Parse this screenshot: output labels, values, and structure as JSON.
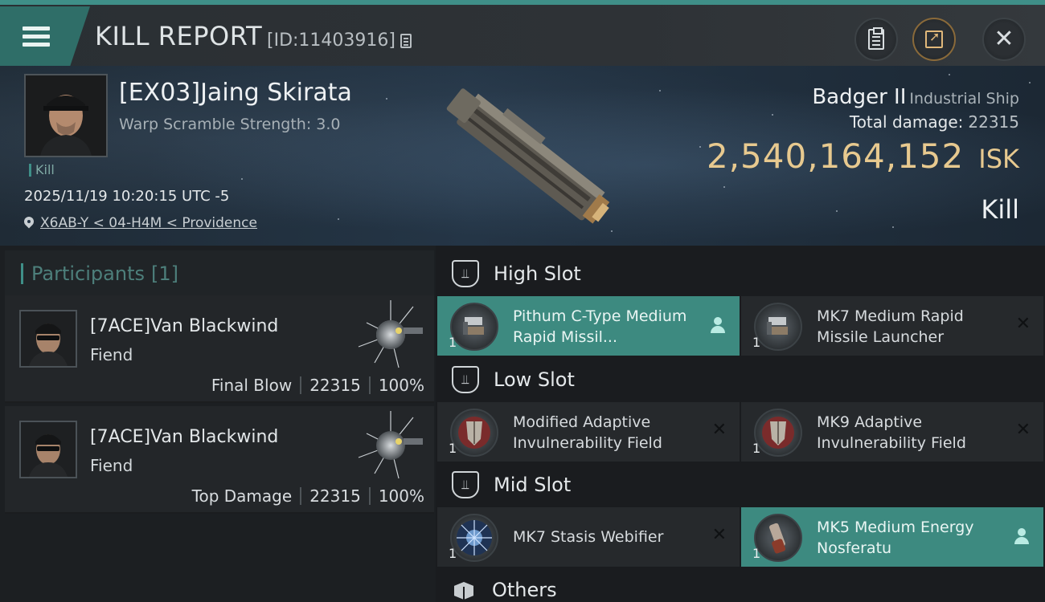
{
  "header": {
    "title": "KILL REPORT",
    "report_id": "[ID:11403916]"
  },
  "victim": {
    "name": "[EX03]Jaing Skirata",
    "warp_scramble": "Warp Scramble Strength: 3.0",
    "tag": "Kill",
    "timestamp": "2025/11/19 10:20:15 UTC -5",
    "location": "X6AB-Y < 04-H4M < Providence"
  },
  "ship": {
    "name": "Badger II",
    "class": "Industrial Ship",
    "total_damage_label": "Total damage:",
    "total_damage_value": "22315",
    "isk_value": "2,540,164,152",
    "isk_unit": "ISK",
    "result": "Kill"
  },
  "participants": {
    "label": "Participants",
    "count": "[1]",
    "items": [
      {
        "name": "[7ACE]Van Blackwind",
        "ship": "Fiend",
        "role": "Final Blow",
        "damage": "22315",
        "percent": "100%"
      },
      {
        "name": "[7ACE]Van Blackwind",
        "ship": "Fiend",
        "role": "Top Damage",
        "damage": "22315",
        "percent": "100%"
      }
    ]
  },
  "slots": {
    "high": {
      "title": "High Slot",
      "modules": [
        {
          "name": "Pithum C-Type Medium Rapid Missil...",
          "qty": "1",
          "status": "fitted"
        },
        {
          "name": "MK7 Medium Rapid Missile Launcher",
          "qty": "1",
          "status": "destroyed"
        }
      ]
    },
    "low": {
      "title": "Low Slot",
      "modules": [
        {
          "name": "Modified Adaptive Invulnerability Field",
          "qty": "1",
          "status": "destroyed"
        },
        {
          "name": "MK9 Adaptive Invulnerability Field",
          "qty": "1",
          "status": "destroyed"
        }
      ]
    },
    "mid": {
      "title": "Mid Slot",
      "modules": [
        {
          "name": "MK7 Stasis Webifier",
          "qty": "1",
          "status": "destroyed"
        },
        {
          "name": "MK5 Medium Energy Nosferatu",
          "qty": "1",
          "status": "fitted"
        }
      ]
    },
    "others": {
      "title": "Others"
    }
  },
  "colors": {
    "accent_teal": "#3d8a80",
    "isk_gold": "#e7c98f",
    "panel_dark": "#1c1f22"
  },
  "icons": {
    "menu": "hamburger-menu-icon",
    "copy": "copy-icon",
    "clipboard": "clipboard-icon",
    "share": "share-icon",
    "close": "close-icon",
    "location": "location-pin-icon",
    "destroyed": "x-mark-icon",
    "dropped": "person-icon",
    "slot": "shield-slot-icon",
    "others": "cube-icon"
  }
}
